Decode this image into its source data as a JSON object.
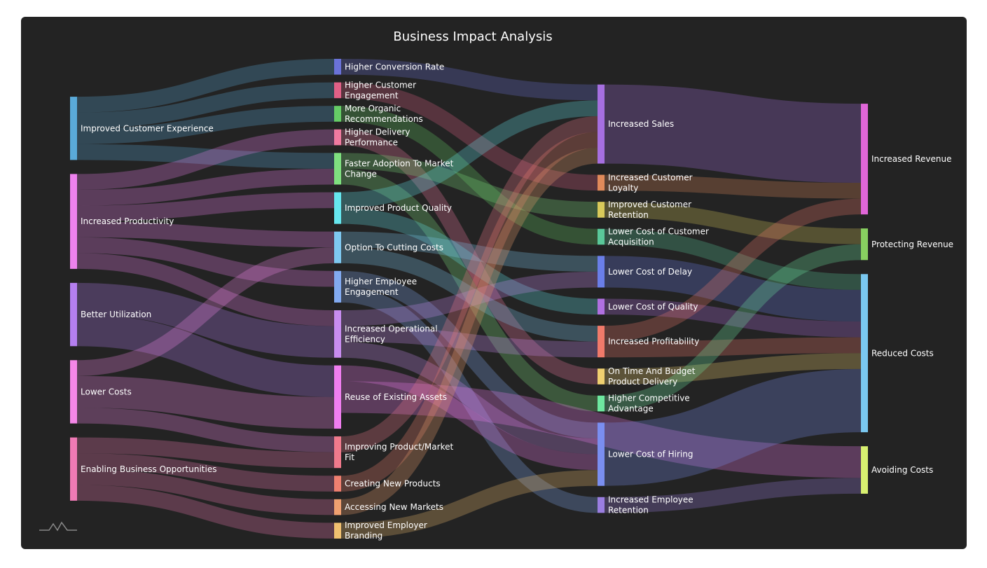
{
  "chart_data": {
    "type": "sankey",
    "title": "Business Impact Analysis",
    "nodes": [
      {
        "id": "ice",
        "label": "Improved Customer Experience",
        "column": 0,
        "color": "#5aaad9"
      },
      {
        "id": "ip",
        "label": "Increased Productivity",
        "column": 0,
        "color": "#ee82ee"
      },
      {
        "id": "bu",
        "label": "Better Utilization",
        "column": 0,
        "color": "#b57ff0"
      },
      {
        "id": "lc",
        "label": "Lower Costs",
        "column": 0,
        "color": "#f587e8"
      },
      {
        "id": "ebo",
        "label": "Enabling Business Opportunities",
        "column": 0,
        "color": "#f07ab5"
      },
      {
        "id": "hcr",
        "label": "Higher Conversion Rate",
        "column": 1,
        "color": "#6a72d8"
      },
      {
        "id": "hce",
        "label": "Higher Customer Engagement",
        "column": 1,
        "color": "#e06086"
      },
      {
        "id": "mor",
        "label": "More Organic Recommendations",
        "column": 1,
        "color": "#66cc66"
      },
      {
        "id": "hdp",
        "label": "Higher Delivery Performance",
        "column": 1,
        "color": "#f07aa0"
      },
      {
        "id": "fatm",
        "label": "Faster Adoption To Market Change",
        "column": 1,
        "color": "#7fe07f"
      },
      {
        "id": "ipq",
        "label": "Improved Product Quality",
        "column": 1,
        "color": "#66e6ee"
      },
      {
        "id": "otcc",
        "label": "Option To Cutting Costs",
        "column": 1,
        "color": "#7ec8f0"
      },
      {
        "id": "hee",
        "label": "Higher Employee Engagement",
        "column": 1,
        "color": "#82aaf0"
      },
      {
        "id": "ioe",
        "label": "Increased Operational Efficiency",
        "column": 1,
        "color": "#c88cf0"
      },
      {
        "id": "rea",
        "label": "Reuse of Existing Assets",
        "column": 1,
        "color": "#f07ef0"
      },
      {
        "id": "ipmf",
        "label": "Improving Product/Market Fit",
        "column": 1,
        "color": "#f07a8c"
      },
      {
        "id": "cnp",
        "label": "Creating New Products",
        "column": 1,
        "color": "#f08070"
      },
      {
        "id": "anm",
        "label": "Accessing New Markets",
        "column": 1,
        "color": "#f0a070"
      },
      {
        "id": "ieb",
        "label": "Improved Employer Branding",
        "column": 1,
        "color": "#f0c070"
      },
      {
        "id": "is",
        "label": "Increased Sales",
        "column": 2,
        "color": "#a66fe0"
      },
      {
        "id": "icl",
        "label": "Increased Customer Loyalty",
        "column": 2,
        "color": "#e08a5a"
      },
      {
        "id": "icr",
        "label": "Improved Customer Retention",
        "column": 2,
        "color": "#d8c95a"
      },
      {
        "id": "lcca",
        "label": "Lower Cost of Customer Acquisition",
        "column": 2,
        "color": "#5ac89a"
      },
      {
        "id": "lcd",
        "label": "Lower Cost of Delay",
        "column": 2,
        "color": "#6a7ee8"
      },
      {
        "id": "lcq",
        "label": "Lower Cost of Quality",
        "column": 2,
        "color": "#b070e0"
      },
      {
        "id": "ipr",
        "label": "Increased Profitability",
        "column": 2,
        "color": "#f07a6a"
      },
      {
        "id": "otbd",
        "label": "On Time And Budget Product Delivery",
        "column": 2,
        "color": "#f0d070"
      },
      {
        "id": "hca",
        "label": "Higher Competitive Advantage",
        "column": 2,
        "color": "#6ee8a0"
      },
      {
        "id": "lch",
        "label": "Lower Cost of Hiring",
        "column": 2,
        "color": "#7a8ef0"
      },
      {
        "id": "ier",
        "label": "Increased Employee Retention",
        "column": 2,
        "color": "#9a7ee0"
      },
      {
        "id": "irev",
        "label": "Increased Revenue",
        "column": 3,
        "color": "#e066d8"
      },
      {
        "id": "prev",
        "label": "Protecting Revenue",
        "column": 3,
        "color": "#88d060"
      },
      {
        "id": "rc",
        "label": "Reduced Costs",
        "column": 3,
        "color": "#7ac8f0"
      },
      {
        "id": "ac",
        "label": "Avoiding Costs",
        "column": 3,
        "color": "#d8f070"
      }
    ],
    "links": [
      {
        "source": "ice",
        "target": "hcr",
        "value": 1
      },
      {
        "source": "ice",
        "target": "hce",
        "value": 1
      },
      {
        "source": "ice",
        "target": "mor",
        "value": 1
      },
      {
        "source": "ice",
        "target": "fatm",
        "value": 1
      },
      {
        "source": "ip",
        "target": "hdp",
        "value": 1
      },
      {
        "source": "ip",
        "target": "fatm",
        "value": 1
      },
      {
        "source": "ip",
        "target": "ipq",
        "value": 1
      },
      {
        "source": "ip",
        "target": "otcc",
        "value": 1
      },
      {
        "source": "ip",
        "target": "hee",
        "value": 1
      },
      {
        "source": "ip",
        "target": "ioe",
        "value": 1
      },
      {
        "source": "bu",
        "target": "ioe",
        "value": 2
      },
      {
        "source": "bu",
        "target": "rea",
        "value": 2
      },
      {
        "source": "lc",
        "target": "rea",
        "value": 2
      },
      {
        "source": "lc",
        "target": "otcc",
        "value": 1
      },
      {
        "source": "lc",
        "target": "ipmf",
        "value": 1
      },
      {
        "source": "ebo",
        "target": "ipmf",
        "value": 1
      },
      {
        "source": "ebo",
        "target": "cnp",
        "value": 1
      },
      {
        "source": "ebo",
        "target": "anm",
        "value": 1
      },
      {
        "source": "ebo",
        "target": "ieb",
        "value": 1
      },
      {
        "source": "hcr",
        "target": "is",
        "value": 1
      },
      {
        "source": "hce",
        "target": "icl",
        "value": 1
      },
      {
        "source": "mor",
        "target": "lcca",
        "value": 1
      },
      {
        "source": "hdp",
        "target": "otbd",
        "value": 1
      },
      {
        "source": "fatm",
        "target": "icr",
        "value": 1
      },
      {
        "source": "fatm",
        "target": "hca",
        "value": 1
      },
      {
        "source": "ipq",
        "target": "is",
        "value": 1
      },
      {
        "source": "ipq",
        "target": "lcq",
        "value": 1
      },
      {
        "source": "otcc",
        "target": "lcd",
        "value": 1
      },
      {
        "source": "otcc",
        "target": "ipr",
        "value": 1
      },
      {
        "source": "hee",
        "target": "ier",
        "value": 1
      },
      {
        "source": "hee",
        "target": "lch",
        "value": 1
      },
      {
        "source": "ioe",
        "target": "lcd",
        "value": 1
      },
      {
        "source": "ioe",
        "target": "ipr",
        "value": 1
      },
      {
        "source": "ioe",
        "target": "lch",
        "value": 1
      },
      {
        "source": "rea",
        "target": "lch",
        "value": 1
      },
      {
        "source": "rea",
        "target": "ac",
        "value": 2
      },
      {
        "source": "ipmf",
        "target": "is",
        "value": 1
      },
      {
        "source": "cnp",
        "target": "is",
        "value": 1
      },
      {
        "source": "anm",
        "target": "is",
        "value": 1
      },
      {
        "source": "ieb",
        "target": "lch",
        "value": 1
      },
      {
        "source": "is",
        "target": "irev",
        "value": 5
      },
      {
        "source": "icl",
        "target": "irev",
        "value": 1
      },
      {
        "source": "icr",
        "target": "prev",
        "value": 1
      },
      {
        "source": "lcca",
        "target": "rc",
        "value": 1
      },
      {
        "source": "lcd",
        "target": "rc",
        "value": 2
      },
      {
        "source": "lcq",
        "target": "rc",
        "value": 1
      },
      {
        "source": "ipr",
        "target": "irev",
        "value": 1
      },
      {
        "source": "ipr",
        "target": "rc",
        "value": 1
      },
      {
        "source": "otbd",
        "target": "rc",
        "value": 1
      },
      {
        "source": "hca",
        "target": "prev",
        "value": 1
      },
      {
        "source": "lch",
        "target": "rc",
        "value": 4
      },
      {
        "source": "ier",
        "target": "ac",
        "value": 1
      }
    ]
  }
}
